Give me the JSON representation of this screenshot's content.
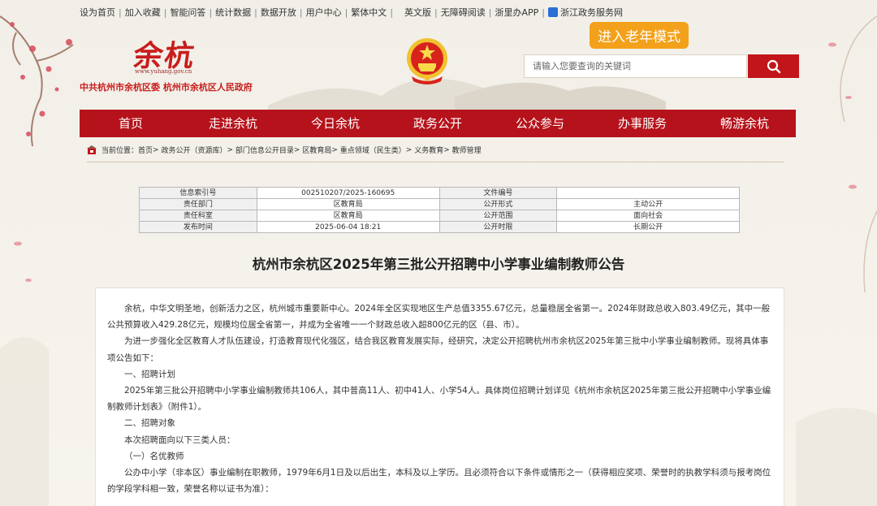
{
  "top_links": {
    "set_home": "设为首页",
    "favorite": "加入收藏",
    "smart_qa": "智能问答",
    "stats": "统计数据",
    "open_data": "数据开放",
    "user_center": "用户中心",
    "traditional": "繁体中文",
    "english": "英文版",
    "accessible": "无障碍阅读",
    "zheliban": "浙里办APP",
    "zj_service": "浙江政务服务网"
  },
  "logo": {
    "brush_text": "余杭",
    "url": "www.yuhang.gov.cn",
    "subtitle": "中共杭州市余杭区委  杭州市余杭区人民政府"
  },
  "elder_mode_label": "进入老年模式",
  "search": {
    "placeholder": "请输入您要查询的关键词"
  },
  "nav": [
    "首页",
    "走进余杭",
    "今日余杭",
    "政务公开",
    "公众参与",
    "办事服务",
    "畅游余杭"
  ],
  "breadcrumb": {
    "prefix": "当前位置：",
    "items": [
      "首页",
      "政务公开（资源库）",
      "部门信息公开目录",
      "区教育局",
      "重点领域（民生类）",
      "义务教育",
      "教师管理"
    ],
    "sep": ">"
  },
  "meta": {
    "rows": [
      [
        "信息索引号",
        "002510207/2025-160695",
        "文件编号",
        ""
      ],
      [
        "责任部门",
        "区教育局",
        "公开形式",
        "主动公开"
      ],
      [
        "责任科室",
        "区教育局",
        "公开范围",
        "面向社会"
      ],
      [
        "发布时间",
        "2025-06-04 18:21",
        "公开时限",
        "长期公开"
      ]
    ]
  },
  "article": {
    "title": "杭州市余杭区2025年第三批公开招聘中小学事业编制教师公告",
    "paragraphs": [
      "余杭，中华文明圣地，创新活力之区，杭州城市重要新中心。2024年全区实现地区生产总值3355.67亿元，总量稳居全省第一。2024年财政总收入803.49亿元，其中一般公共预算收入429.28亿元，规模均位居全省第一，并成为全省唯一一个财政总收入超800亿元的区（县、市）。",
      "为进一步强化全区教育人才队伍建设，打造教育现代化强区，结合我区教育发展实际，经研究，决定公开招聘杭州市余杭区2025年第三批中小学事业编制教师。现将具体事项公告如下：",
      "一、招聘计划",
      "2025年第三批公开招聘中小学事业编制教师共106人，其中普高11人、初中41人、小学54人。具体岗位招聘计划详见《杭州市余杭区2025年第三批公开招聘中小学事业编制教师计划表》（附件1）。",
      "二、招聘对象",
      "本次招聘面向以下三类人员：",
      "（一）名优教师",
      "公办中小学（非本区）事业编制在职教师，1979年6月1日及以后出生，本科及以上学历。且必须符合以下条件或情形之一（获得相应奖项、荣誉时的执教学科须与报考岗位的学段学科相一致，荣誉名称以证书为准）："
    ]
  }
}
